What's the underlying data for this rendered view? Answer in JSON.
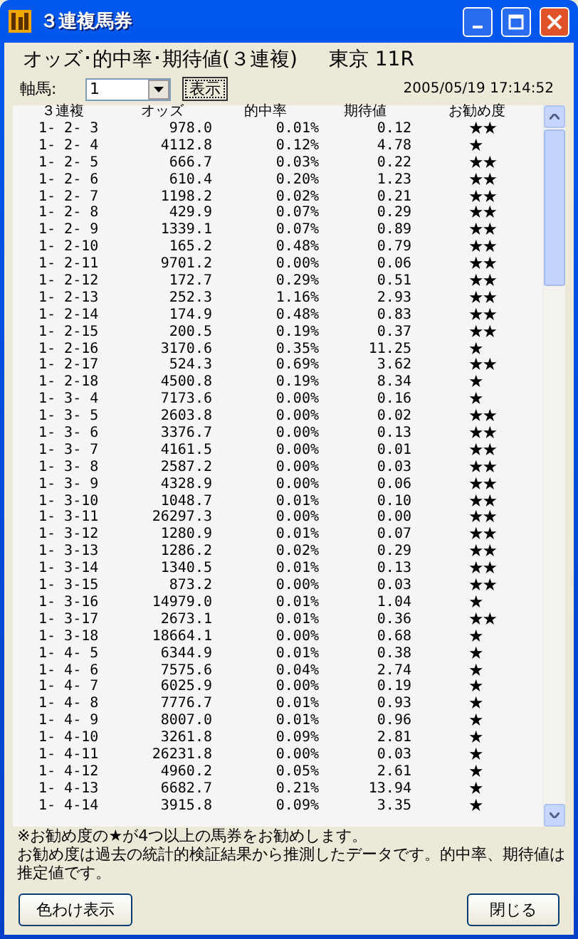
{
  "window": {
    "title": "３連複馬券"
  },
  "heading": {
    "title": "オッズ･的中率･期待値(３連複)",
    "venue": "東京 11R"
  },
  "controls": {
    "label": "軸馬:",
    "select_value": "1",
    "button": "表示",
    "timestamp": "2005/05/19 17:14:52"
  },
  "table": {
    "columns": [
      "３連複",
      "オッズ",
      "的中率",
      "期待値",
      "お勧め度"
    ],
    "rows": [
      {
        "combo": "1- 2- 3",
        "odds": "978.0",
        "hit_rate": "0.01%",
        "expected": "0.12",
        "rating": "★★"
      },
      {
        "combo": "1- 2- 4",
        "odds": "4112.8",
        "hit_rate": "0.12%",
        "expected": "4.78",
        "rating": "★"
      },
      {
        "combo": "1- 2- 5",
        "odds": "666.7",
        "hit_rate": "0.03%",
        "expected": "0.22",
        "rating": "★★"
      },
      {
        "combo": "1- 2- 6",
        "odds": "610.4",
        "hit_rate": "0.20%",
        "expected": "1.23",
        "rating": "★★"
      },
      {
        "combo": "1- 2- 7",
        "odds": "1198.2",
        "hit_rate": "0.02%",
        "expected": "0.21",
        "rating": "★★"
      },
      {
        "combo": "1- 2- 8",
        "odds": "429.9",
        "hit_rate": "0.07%",
        "expected": "0.29",
        "rating": "★★"
      },
      {
        "combo": "1- 2- 9",
        "odds": "1339.1",
        "hit_rate": "0.07%",
        "expected": "0.89",
        "rating": "★★"
      },
      {
        "combo": "1- 2-10",
        "odds": "165.2",
        "hit_rate": "0.48%",
        "expected": "0.79",
        "rating": "★★"
      },
      {
        "combo": "1- 2-11",
        "odds": "9701.2",
        "hit_rate": "0.00%",
        "expected": "0.06",
        "rating": "★★"
      },
      {
        "combo": "1- 2-12",
        "odds": "172.7",
        "hit_rate": "0.29%",
        "expected": "0.51",
        "rating": "★★"
      },
      {
        "combo": "1- 2-13",
        "odds": "252.3",
        "hit_rate": "1.16%",
        "expected": "2.93",
        "rating": "★★"
      },
      {
        "combo": "1- 2-14",
        "odds": "174.9",
        "hit_rate": "0.48%",
        "expected": "0.83",
        "rating": "★★"
      },
      {
        "combo": "1- 2-15",
        "odds": "200.5",
        "hit_rate": "0.19%",
        "expected": "0.37",
        "rating": "★★"
      },
      {
        "combo": "1- 2-16",
        "odds": "3170.6",
        "hit_rate": "0.35%",
        "expected": "11.25",
        "rating": "★"
      },
      {
        "combo": "1- 2-17",
        "odds": "524.3",
        "hit_rate": "0.69%",
        "expected": "3.62",
        "rating": "★★"
      },
      {
        "combo": "1- 2-18",
        "odds": "4500.8",
        "hit_rate": "0.19%",
        "expected": "8.34",
        "rating": "★"
      },
      {
        "combo": "1- 3- 4",
        "odds": "7173.6",
        "hit_rate": "0.00%",
        "expected": "0.16",
        "rating": "★"
      },
      {
        "combo": "1- 3- 5",
        "odds": "2603.8",
        "hit_rate": "0.00%",
        "expected": "0.02",
        "rating": "★★"
      },
      {
        "combo": "1- 3- 6",
        "odds": "3376.7",
        "hit_rate": "0.00%",
        "expected": "0.13",
        "rating": "★★"
      },
      {
        "combo": "1- 3- 7",
        "odds": "4161.5",
        "hit_rate": "0.00%",
        "expected": "0.01",
        "rating": "★★"
      },
      {
        "combo": "1- 3- 8",
        "odds": "2587.2",
        "hit_rate": "0.00%",
        "expected": "0.03",
        "rating": "★★"
      },
      {
        "combo": "1- 3- 9",
        "odds": "4328.9",
        "hit_rate": "0.00%",
        "expected": "0.06",
        "rating": "★★"
      },
      {
        "combo": "1- 3-10",
        "odds": "1048.7",
        "hit_rate": "0.01%",
        "expected": "0.10",
        "rating": "★★"
      },
      {
        "combo": "1- 3-11",
        "odds": "26297.3",
        "hit_rate": "0.00%",
        "expected": "0.00",
        "rating": "★★"
      },
      {
        "combo": "1- 3-12",
        "odds": "1280.9",
        "hit_rate": "0.01%",
        "expected": "0.07",
        "rating": "★★"
      },
      {
        "combo": "1- 3-13",
        "odds": "1286.2",
        "hit_rate": "0.02%",
        "expected": "0.29",
        "rating": "★★"
      },
      {
        "combo": "1- 3-14",
        "odds": "1340.5",
        "hit_rate": "0.01%",
        "expected": "0.13",
        "rating": "★★"
      },
      {
        "combo": "1- 3-15",
        "odds": "873.2",
        "hit_rate": "0.00%",
        "expected": "0.03",
        "rating": "★★"
      },
      {
        "combo": "1- 3-16",
        "odds": "14979.0",
        "hit_rate": "0.01%",
        "expected": "1.04",
        "rating": "★"
      },
      {
        "combo": "1- 3-17",
        "odds": "2673.1",
        "hit_rate": "0.01%",
        "expected": "0.36",
        "rating": "★★"
      },
      {
        "combo": "1- 3-18",
        "odds": "18664.1",
        "hit_rate": "0.00%",
        "expected": "0.68",
        "rating": "★"
      },
      {
        "combo": "1- 4- 5",
        "odds": "6344.9",
        "hit_rate": "0.01%",
        "expected": "0.38",
        "rating": "★"
      },
      {
        "combo": "1- 4- 6",
        "odds": "7575.6",
        "hit_rate": "0.04%",
        "expected": "2.74",
        "rating": "★"
      },
      {
        "combo": "1- 4- 7",
        "odds": "6025.9",
        "hit_rate": "0.00%",
        "expected": "0.19",
        "rating": "★"
      },
      {
        "combo": "1- 4- 8",
        "odds": "7776.7",
        "hit_rate": "0.01%",
        "expected": "0.93",
        "rating": "★"
      },
      {
        "combo": "1- 4- 9",
        "odds": "8007.0",
        "hit_rate": "0.01%",
        "expected": "0.96",
        "rating": "★"
      },
      {
        "combo": "1- 4-10",
        "odds": "3261.8",
        "hit_rate": "0.09%",
        "expected": "2.81",
        "rating": "★"
      },
      {
        "combo": "1- 4-11",
        "odds": "26231.8",
        "hit_rate": "0.00%",
        "expected": "0.03",
        "rating": "★"
      },
      {
        "combo": "1- 4-12",
        "odds": "4960.2",
        "hit_rate": "0.05%",
        "expected": "2.61",
        "rating": "★"
      },
      {
        "combo": "1- 4-13",
        "odds": "6682.7",
        "hit_rate": "0.21%",
        "expected": "13.94",
        "rating": "★"
      },
      {
        "combo": "1- 4-14",
        "odds": "3915.8",
        "hit_rate": "0.09%",
        "expected": "3.35",
        "rating": "★"
      }
    ]
  },
  "notes": [
    "※お勧め度の**★**が4つ以上の馬券をお勧めします。",
    "お勧め度は過去の統計的検証結果から推測したデータです。的中率、期待値は推定値です。"
  ],
  "buttons": {
    "color_view": "色わけ表示",
    "close": "閉じる"
  }
}
